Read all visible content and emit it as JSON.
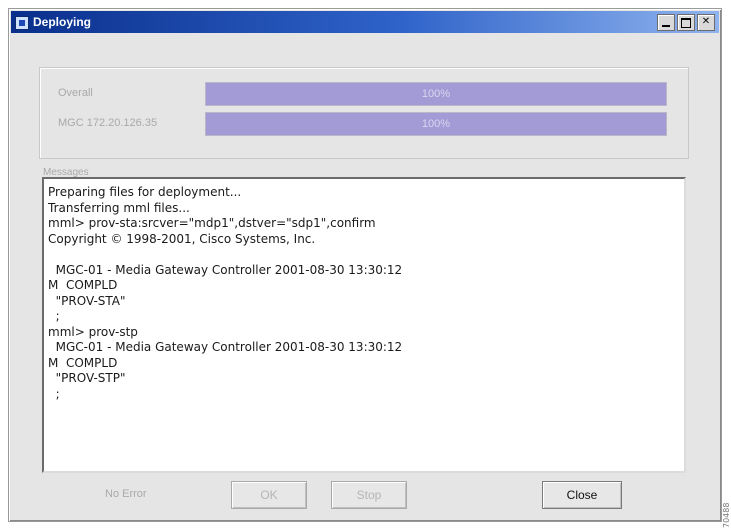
{
  "window": {
    "title": "Deploying",
    "controls": [
      "minimize",
      "maximize",
      "close"
    ]
  },
  "progress": {
    "overall_label": "Overall",
    "overall_text": "100%",
    "overall_fraction": 1.0,
    "host_label": "MGC 172.20.126.35",
    "host_text": "100%",
    "host_fraction": 1.0
  },
  "messages": {
    "legend": "Messages",
    "lines": [
      "Preparing files for deployment...",
      "Transferring mml files...",
      "mml> prov-sta:srcver=\"mdp1\",dstver=\"sdp1\",confirm",
      "Copyright © 1998-2001, Cisco Systems, Inc.",
      "",
      "  MGC-01 - Media Gateway Controller 2001-08-30 13:30:12",
      "M  COMPLD",
      "  \"PROV-STA\"",
      "  ;",
      "mml> prov-stp",
      "  MGC-01 - Media Gateway Controller 2001-08-30 13:30:12",
      "M  COMPLD",
      "  \"PROV-STP\"",
      "  ;"
    ]
  },
  "footer": {
    "status": "No Error",
    "button1": "OK",
    "button2": "Stop",
    "close": "Close"
  },
  "side_id": "70488",
  "colors": {
    "titlebar_start": "#0a2f8c",
    "titlebar_end": "#8fb3ee",
    "progress_fill": "#a29bd6"
  }
}
